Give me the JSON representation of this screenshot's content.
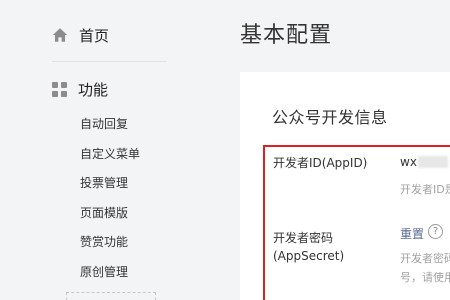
{
  "sidebar": {
    "home_label": "首页",
    "home_icon": "home-icon",
    "function_label": "功能",
    "function_icon": "grid-icon",
    "items": [
      {
        "label": "自动回复"
      },
      {
        "label": "自定义菜单"
      },
      {
        "label": "投票管理"
      },
      {
        "label": "页面模版"
      },
      {
        "label": "赞赏功能"
      },
      {
        "label": "原创管理"
      }
    ]
  },
  "main": {
    "title": "基本配置",
    "section_title": "公众号开发信息",
    "appid": {
      "label": "开发者ID(AppID)",
      "value_visible": "wx",
      "hint": "开发者ID是"
    },
    "secret": {
      "label_line1": "开发者密码",
      "label_line2": "(AppSecret)",
      "reset_label": "重置",
      "help_glyph": "?",
      "hint_line1": "开发者密码",
      "hint_line2": "号，请使用"
    }
  },
  "colors": {
    "highlight_border": "#e02020",
    "link": "#576b95",
    "background": "#f3f4f6",
    "panel": "#ffffff"
  }
}
